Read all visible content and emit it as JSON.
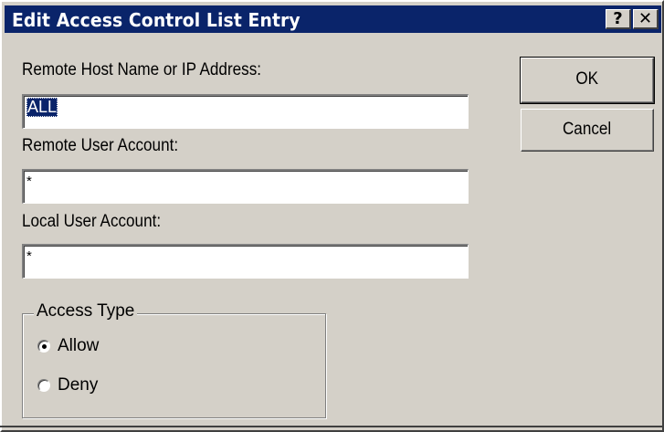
{
  "dialog": {
    "title": "Edit Access Control List Entry",
    "help_glyph": "?",
    "close_glyph": "✕"
  },
  "form": {
    "remote_host_label": "Remote Host Name or IP Address:",
    "remote_host_value": "ALL",
    "remote_user_label": "Remote User Account:",
    "remote_user_value": "*",
    "local_user_label": "Local User Account:",
    "local_user_value": "*"
  },
  "buttons": {
    "ok": "OK",
    "cancel": "Cancel"
  },
  "access_type": {
    "legend": "Access Type",
    "options": [
      {
        "label": "Allow",
        "checked": true
      },
      {
        "label": "Deny",
        "checked": false
      }
    ]
  },
  "colors": {
    "titlebar": "#0a246a",
    "dialog_bg": "#d4d0c8",
    "selection": "#0a246a"
  }
}
